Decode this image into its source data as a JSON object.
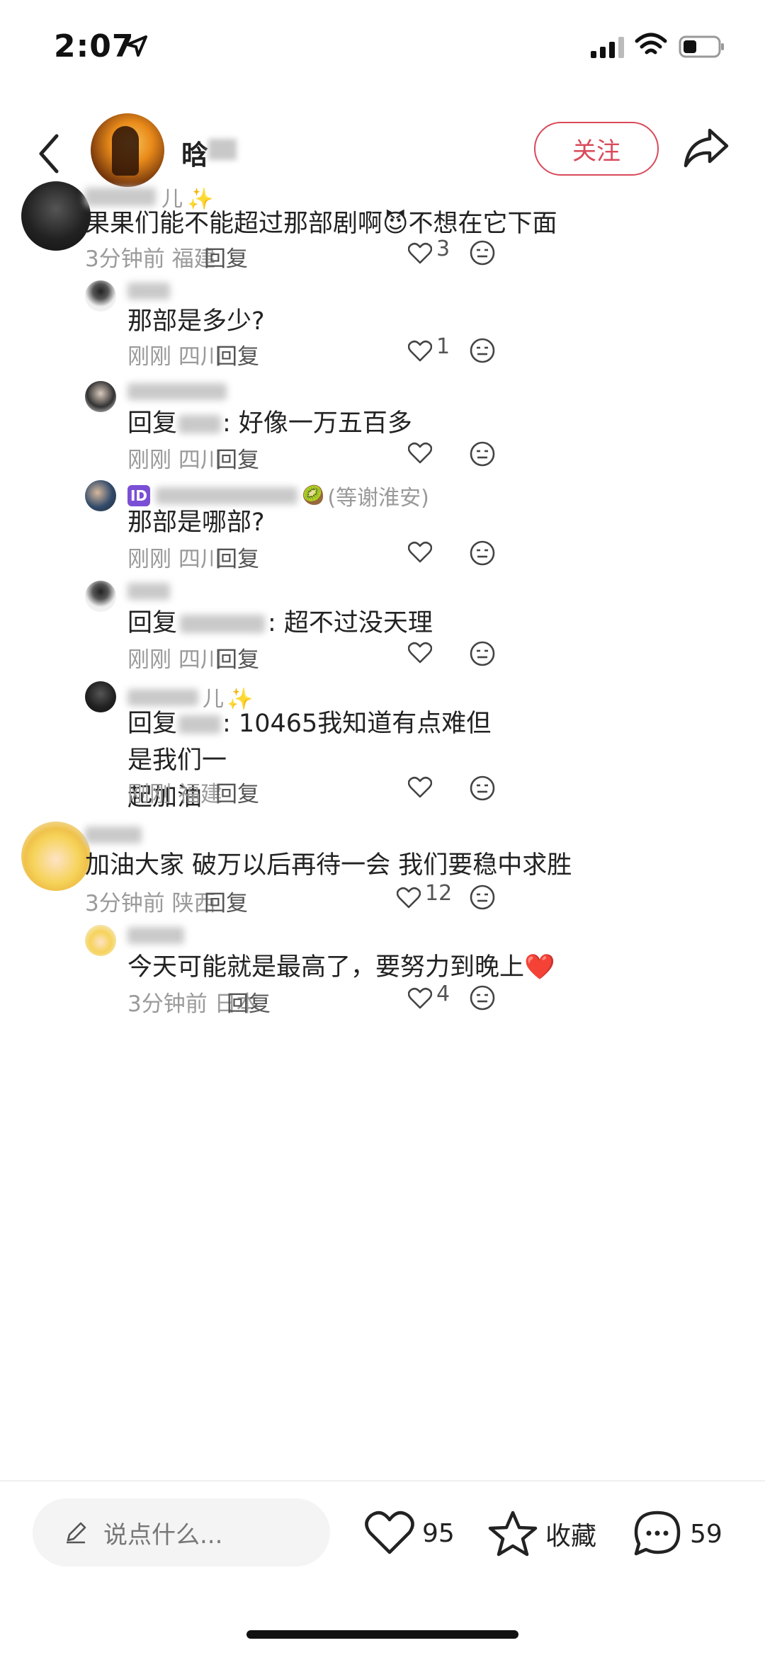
{
  "status_bar": {
    "time": "2:07"
  },
  "header": {
    "author_name": "晗",
    "follow_label": "关注"
  },
  "comments": [
    {
      "text": "果果们能不能超过那部剧啊😈不想在它下面",
      "time": "3分钟前",
      "location": "福建",
      "reply_label": "回复",
      "likes": "3"
    },
    {
      "text": "那部是多少?",
      "time": "刚刚",
      "location": "四川",
      "reply_label": "回复",
      "likes": "1"
    },
    {
      "text_prefix": "回复",
      "text_suffix": ": 好像一万五百多",
      "time": "刚刚",
      "location": "四川",
      "reply_label": "回复",
      "likes": ""
    },
    {
      "badge_note": "(等谢淮安)",
      "text": "那部是哪部?",
      "time": "刚刚",
      "location": "四川",
      "reply_label": "回复",
      "likes": ""
    },
    {
      "text_prefix": "回复",
      "text_suffix": ": 超不过没天理",
      "time": "刚刚",
      "location": "四川",
      "reply_label": "回复",
      "likes": ""
    },
    {
      "text_prefix": "回复",
      "text_line1": ": 10465我知道有点难但是我们一",
      "text_line2": "起加油",
      "time": "刚刚",
      "location": "福建",
      "reply_label": "回复",
      "likes": ""
    },
    {
      "text": "加油大家 破万以后再待一会 我们要稳中求胜",
      "time": "3分钟前",
      "location": "陕西",
      "reply_label": "回复",
      "likes": "12"
    },
    {
      "text": "今天可能就是最高了，要努力到晚上❤️",
      "time": "3分钟前",
      "location": "日本",
      "reply_label": "回复",
      "likes": "4"
    }
  ],
  "bottom_bar": {
    "input_placeholder": "说点什么...",
    "likes": "95",
    "collect_label": "收藏",
    "comments": "59"
  }
}
